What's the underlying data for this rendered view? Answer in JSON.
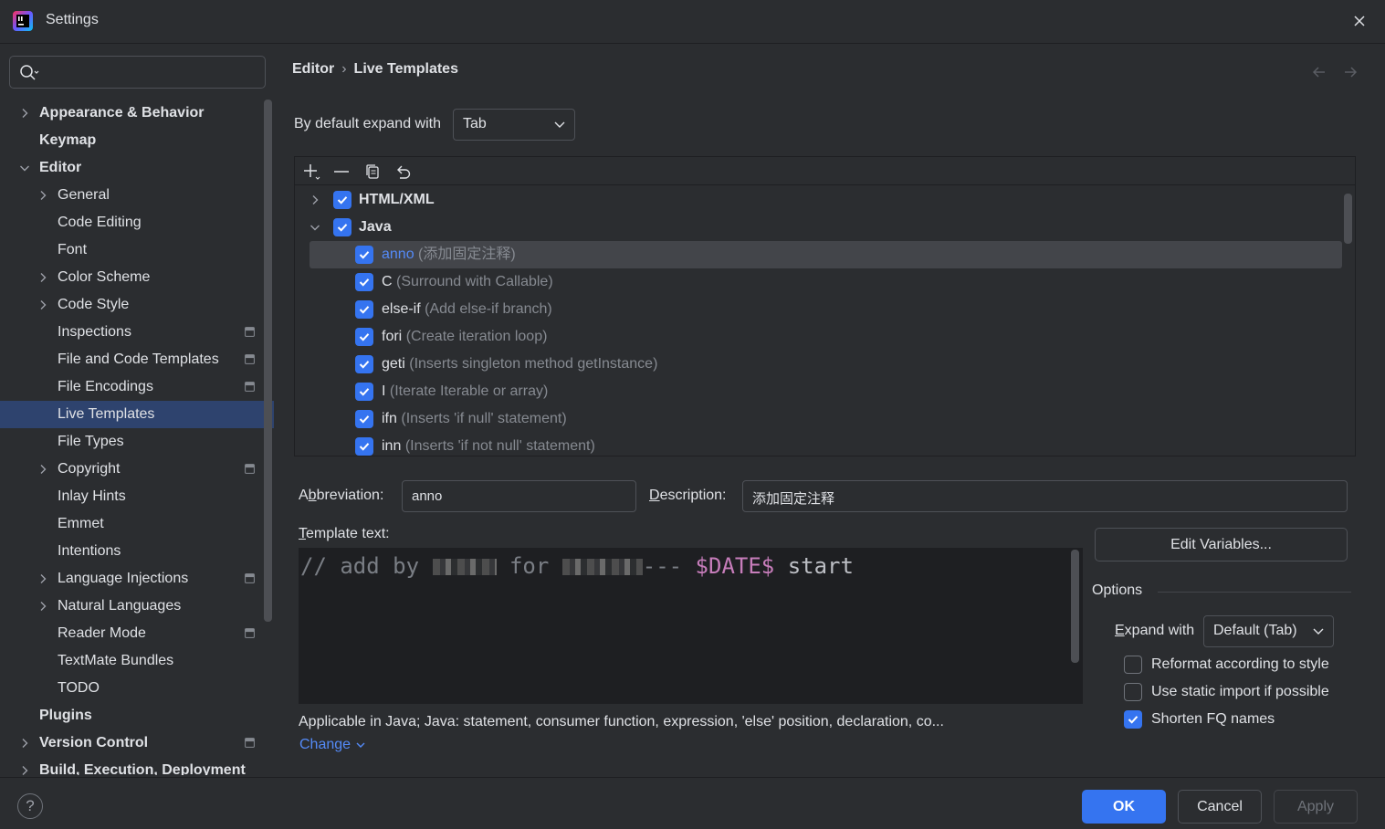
{
  "window": {
    "title": "Settings"
  },
  "search": {
    "placeholder": ""
  },
  "sidebar": {
    "items": [
      {
        "label": "Appearance & Behavior",
        "level": 0,
        "bold": true,
        "expandable": true,
        "expanded": false,
        "project": false
      },
      {
        "label": "Keymap",
        "level": 0,
        "bold": true,
        "expandable": false,
        "project": false
      },
      {
        "label": "Editor",
        "level": 0,
        "bold": true,
        "expandable": true,
        "expanded": true,
        "project": false
      },
      {
        "label": "General",
        "level": 1,
        "expandable": true,
        "expanded": false,
        "project": false
      },
      {
        "label": "Code Editing",
        "level": 1,
        "expandable": false,
        "project": false
      },
      {
        "label": "Font",
        "level": 1,
        "expandable": false,
        "project": false
      },
      {
        "label": "Color Scheme",
        "level": 1,
        "expandable": true,
        "expanded": false,
        "project": false
      },
      {
        "label": "Code Style",
        "level": 1,
        "expandable": true,
        "expanded": false,
        "project": false
      },
      {
        "label": "Inspections",
        "level": 1,
        "expandable": false,
        "project": true
      },
      {
        "label": "File and Code Templates",
        "level": 1,
        "expandable": false,
        "project": true
      },
      {
        "label": "File Encodings",
        "level": 1,
        "expandable": false,
        "project": true
      },
      {
        "label": "Live Templates",
        "level": 1,
        "expandable": false,
        "project": false,
        "selected": true
      },
      {
        "label": "File Types",
        "level": 1,
        "expandable": false,
        "project": false
      },
      {
        "label": "Copyright",
        "level": 1,
        "expandable": true,
        "expanded": false,
        "project": true
      },
      {
        "label": "Inlay Hints",
        "level": 1,
        "expandable": false,
        "project": false
      },
      {
        "label": "Emmet",
        "level": 1,
        "expandable": false,
        "project": false
      },
      {
        "label": "Intentions",
        "level": 1,
        "expandable": false,
        "project": false
      },
      {
        "label": "Language Injections",
        "level": 1,
        "expandable": true,
        "expanded": false,
        "project": true
      },
      {
        "label": "Natural Languages",
        "level": 1,
        "expandable": true,
        "expanded": false,
        "project": false
      },
      {
        "label": "Reader Mode",
        "level": 1,
        "expandable": false,
        "project": true
      },
      {
        "label": "TextMate Bundles",
        "level": 1,
        "expandable": false,
        "project": false
      },
      {
        "label": "TODO",
        "level": 1,
        "expandable": false,
        "project": false
      },
      {
        "label": "Plugins",
        "level": 0,
        "bold": true,
        "expandable": false,
        "project": false
      },
      {
        "label": "Version Control",
        "level": 0,
        "bold": true,
        "expandable": true,
        "expanded": false,
        "project": true
      },
      {
        "label": "Build, Execution, Deployment",
        "level": 0,
        "bold": true,
        "expandable": true,
        "expanded": false,
        "project": false
      }
    ]
  },
  "breadcrumb": {
    "parent": "Editor",
    "separator": "›",
    "current": "Live Templates"
  },
  "expand_default": {
    "label": "By default expand with",
    "value": "Tab"
  },
  "templates": {
    "groups": [
      {
        "name": "HTML/XML",
        "checked": true,
        "expanded": false
      },
      {
        "name": "Java",
        "checked": true,
        "expanded": true
      }
    ],
    "items": [
      {
        "abbr": "anno",
        "desc": "(添加固定注释)",
        "checked": true,
        "selected": true
      },
      {
        "abbr": "C",
        "desc": "(Surround with Callable)",
        "checked": true
      },
      {
        "abbr": "else-if",
        "desc": "(Add else-if branch)",
        "checked": true
      },
      {
        "abbr": "fori",
        "desc": "(Create iteration loop)",
        "checked": true
      },
      {
        "abbr": "geti",
        "desc": "(Inserts singleton method getInstance)",
        "checked": true
      },
      {
        "abbr": "I",
        "desc": "(Iterate Iterable or array)",
        "checked": true
      },
      {
        "abbr": "ifn",
        "desc": "(Inserts 'if null' statement)",
        "checked": true
      },
      {
        "abbr": "inn",
        "desc": "(Inserts 'if not null' statement)",
        "checked": true
      }
    ]
  },
  "abbreviation": {
    "label_pre": "A",
    "label_mnemonic": "b",
    "label_post": "breviation:",
    "value": "anno"
  },
  "description": {
    "label_mnemonic": "D",
    "label_post": "escription:",
    "value": "添加固定注释"
  },
  "template_text": {
    "label_mnemonic": "T",
    "label_post": "emplate text:",
    "part1": "// add by ",
    "part2": " for ",
    "part3": "--- ",
    "variable": "$DATE$",
    "part4": " start"
  },
  "edit_variables_label": "Edit Variables...",
  "options": {
    "title": "Options",
    "expand_with": {
      "label_mnemonic": "E",
      "label_post": "xpand with",
      "value": "Default (Tab)"
    },
    "checkboxes": [
      {
        "label": "Reformat according to style",
        "checked": false
      },
      {
        "label": "Use static import if possible",
        "checked": false
      },
      {
        "label": "Shorten FQ names",
        "checked": true
      }
    ]
  },
  "applicable": {
    "text": "Applicable in Java; Java: statement, consumer function, expression, 'else' position, declaration, co...",
    "change_label": "Change"
  },
  "footer": {
    "help": "?",
    "ok": "OK",
    "cancel": "Cancel",
    "apply": "Apply"
  },
  "colors": {
    "accent": "#3574f0",
    "selection": "#2e436e",
    "background": "#2b2d30",
    "editor_bg": "#1e1f22",
    "link": "#548af7",
    "template_var": "#c77dbb"
  }
}
